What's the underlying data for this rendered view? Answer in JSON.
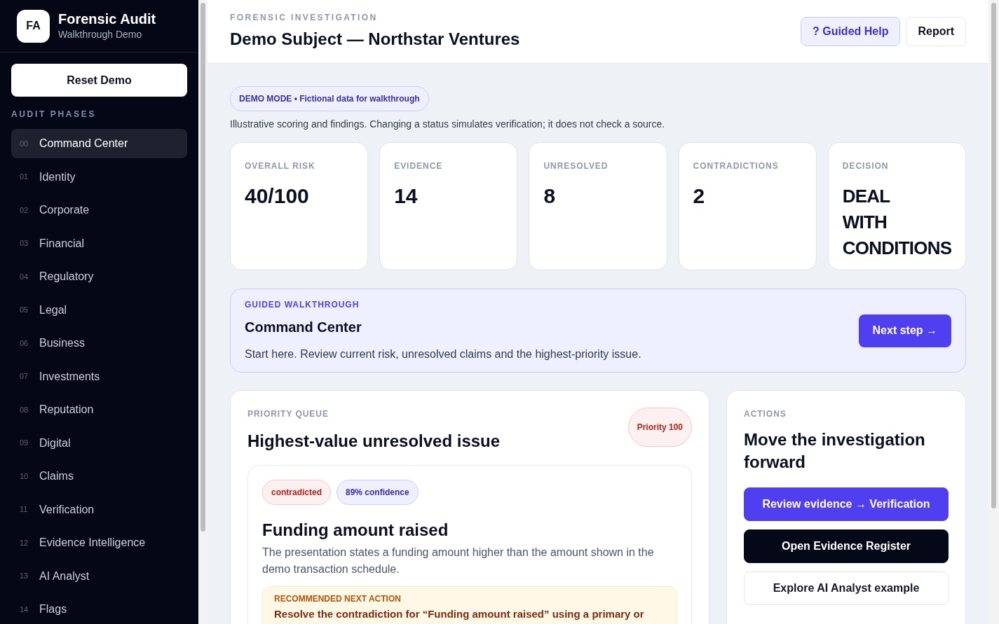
{
  "brand": {
    "logo": "FA",
    "title": "Forensic Audit",
    "subtitle": "Walkthrough Demo"
  },
  "sidebar": {
    "reset_button": "Reset Demo",
    "section_label": "AUDIT PHASES",
    "items": [
      {
        "number": "00",
        "label": "Command Center",
        "selected": true
      },
      {
        "number": "01",
        "label": "Identity",
        "selected": false
      },
      {
        "number": "02",
        "label": "Corporate",
        "selected": false
      },
      {
        "number": "03",
        "label": "Financial",
        "selected": false
      },
      {
        "number": "04",
        "label": "Regulatory",
        "selected": false
      },
      {
        "number": "05",
        "label": "Legal",
        "selected": false
      },
      {
        "number": "06",
        "label": "Business",
        "selected": false
      },
      {
        "number": "07",
        "label": "Investments",
        "selected": false
      },
      {
        "number": "08",
        "label": "Reputation",
        "selected": false
      },
      {
        "number": "09",
        "label": "Digital",
        "selected": false
      },
      {
        "number": "10",
        "label": "Claims",
        "selected": false
      },
      {
        "number": "11",
        "label": "Verification",
        "selected": false
      },
      {
        "number": "12",
        "label": "Evidence Intelligence",
        "selected": false
      },
      {
        "number": "13",
        "label": "AI Analyst",
        "selected": false
      },
      {
        "number": "14",
        "label": "Flags",
        "selected": false
      }
    ]
  },
  "header": {
    "eyebrow": "FORENSIC INVESTIGATION",
    "title": "Demo Subject — Northstar Ventures",
    "buttons": [
      {
        "label": "? Guided Help",
        "kind": "accent"
      },
      {
        "label": "Report",
        "kind": "plain"
      }
    ]
  },
  "notice": {
    "badge": "DEMO MODE • Fictional data for walkthrough",
    "text": "Illustrative scoring and findings. Changing a status simulates verification; it does not check a source."
  },
  "stats": [
    {
      "label": "OVERALL RISK",
      "value": "40/100",
      "kind": "number"
    },
    {
      "label": "EVIDENCE",
      "value": "14",
      "kind": "number"
    },
    {
      "label": "UNRESOLVED",
      "value": "8",
      "kind": "number"
    },
    {
      "label": "CONTRADICTIONS",
      "value": "2",
      "kind": "number"
    },
    {
      "label": "DECISION",
      "value": "DEAL WITH CONDITIONS",
      "kind": "text"
    }
  ],
  "walkthrough": {
    "eyebrow": "GUIDED WALKTHROUGH",
    "title": "Command Center",
    "text": "Start here. Review current risk, unresolved claims and the highest-priority issue.",
    "button": "Next step →"
  },
  "priority": {
    "eyebrow": "PRIORITY QUEUE",
    "title": "Highest-value unresolved issue",
    "badge": "Priority 100",
    "issue": {
      "tags": [
        {
          "label": "contradicted",
          "kind": "danger"
        },
        {
          "label": "89% confidence",
          "kind": "info"
        }
      ],
      "title": "Funding amount raised",
      "text": "The presentation states a funding amount higher than the amount shown in the demo transaction schedule.",
      "recommendation": {
        "label": "RECOMMENDED NEXT ACTION",
        "text": "Resolve the contradiction for “Funding amount raised” using a primary or"
      }
    }
  },
  "actions": {
    "eyebrow": "ACTIONS",
    "title": "Move the investigation forward",
    "buttons": [
      {
        "label": "Review evidence → Verification",
        "kind": "primary"
      },
      {
        "label": "Open Evidence Register",
        "kind": "dark"
      },
      {
        "label": "Explore AI Analyst example",
        "kind": "outline"
      }
    ]
  }
}
